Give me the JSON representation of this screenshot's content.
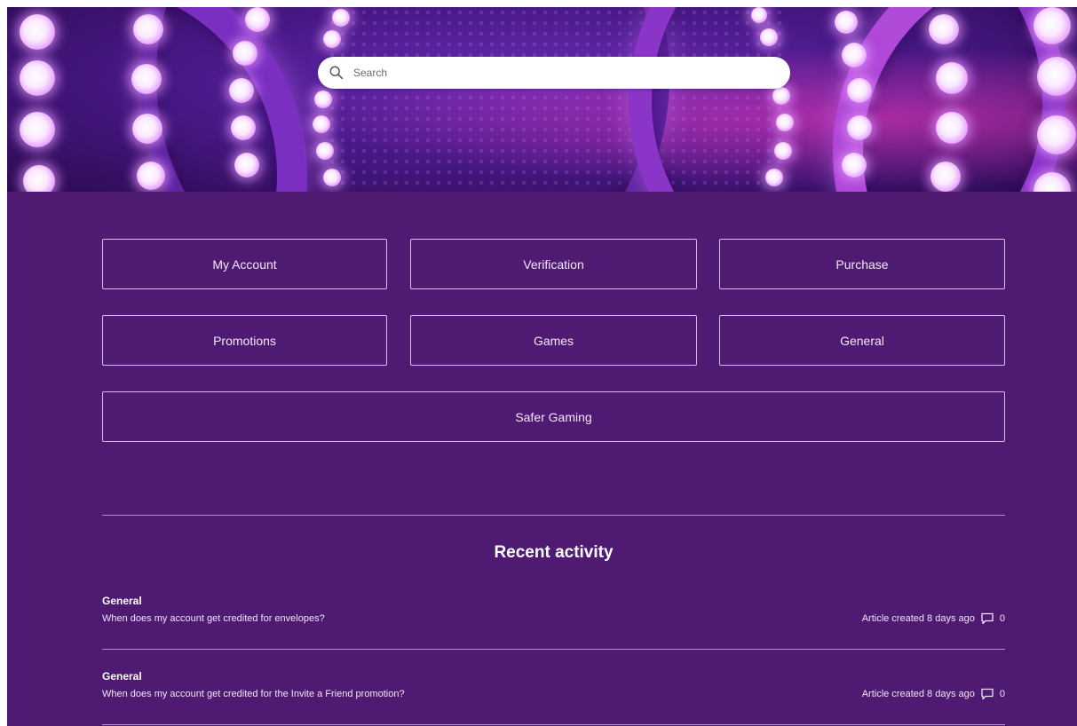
{
  "search": {
    "placeholder": "Search"
  },
  "categories": [
    {
      "label": "My Account"
    },
    {
      "label": "Verification"
    },
    {
      "label": "Purchase"
    },
    {
      "label": "Promotions"
    },
    {
      "label": "Games"
    },
    {
      "label": "General"
    },
    {
      "label": "Safer Gaming"
    }
  ],
  "recent": {
    "title": "Recent activity",
    "items": [
      {
        "section": "General",
        "title": "When does my account get credited for envelopes?",
        "meta": "Article created 8 days ago",
        "comments": "0"
      },
      {
        "section": "General",
        "title": "When does my account get credited for the Invite a Friend promotion?",
        "meta": "Article created 8 days ago",
        "comments": "0"
      }
    ]
  },
  "icons": {
    "search": "search-icon",
    "comment": "comment-icon"
  },
  "colors": {
    "background": "#4f1a72",
    "border": "#d7bfe8",
    "text": "#ffffff"
  }
}
